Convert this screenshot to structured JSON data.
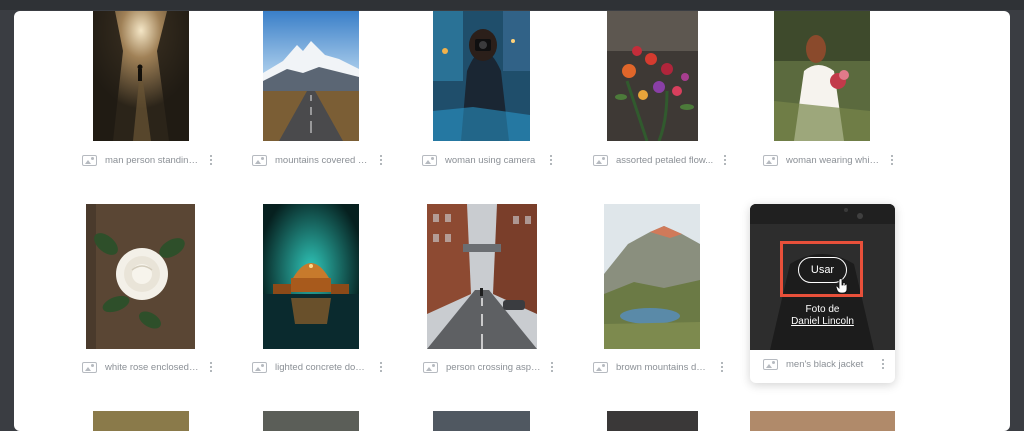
{
  "gallery": {
    "row1": [
      {
        "caption": "man person standing ..."
      },
      {
        "caption": "mountains covered wit..."
      },
      {
        "caption": "woman using camera"
      },
      {
        "caption": "assorted petaled flow..."
      },
      {
        "caption": "woman wearing white ..."
      }
    ],
    "row2": [
      {
        "caption": "white rose enclosed p..."
      },
      {
        "caption": "lighted concrete dome..."
      },
      {
        "caption": "person crossing asph..."
      },
      {
        "caption": "brown mountains duri..."
      }
    ],
    "hovered": {
      "caption": "men's black jacket",
      "use_label": "Usar",
      "credit_prefix": "Foto de",
      "credit_author": "Daniel Lincoln"
    }
  },
  "colors": {
    "highlight": "#e8503a",
    "caption_text": "#8b9096",
    "panel_bg": "#ffffff",
    "page_bg": "#3a3d42"
  },
  "icons": {
    "thumbnail_type": "image-icon",
    "menu": "kebab-menu-icon",
    "cursor": "hand-pointer-icon"
  }
}
